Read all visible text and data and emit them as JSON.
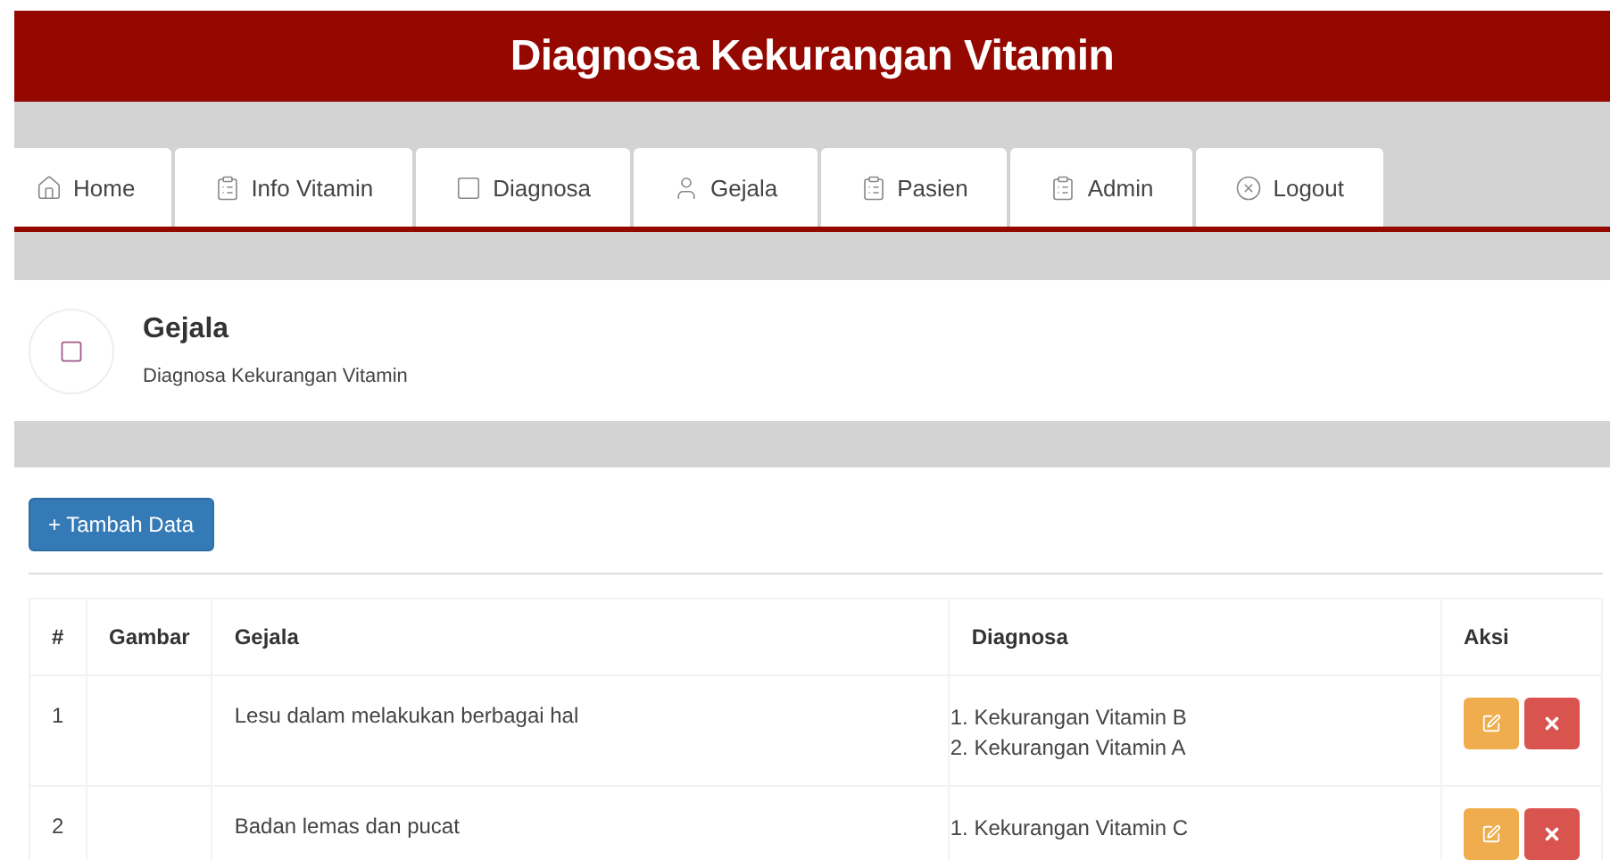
{
  "banner": {
    "title": "Diagnosa Kekurangan Vitamin"
  },
  "nav": [
    {
      "label": "Home",
      "kind": "home"
    },
    {
      "label": "Info Vitamin",
      "kind": "clipboard"
    },
    {
      "label": "Diagnosa",
      "kind": "square"
    },
    {
      "label": "Gejala",
      "kind": "user"
    },
    {
      "label": "Pasien",
      "kind": "clipboard"
    },
    {
      "label": "Admin",
      "kind": "clipboard"
    },
    {
      "label": "Logout",
      "kind": "logout"
    }
  ],
  "page_header": {
    "title": "Gejala",
    "subtitle": "Diagnosa Kekurangan Vitamin"
  },
  "add_button": "+ Tambah Data",
  "table": {
    "columns": [
      "#",
      "Gambar",
      "Gejala",
      "Diagnosa",
      "Aksi"
    ],
    "rows": [
      {
        "no": "1",
        "gejala": "Lesu dalam melakukan berbagai hal",
        "diagnosa": [
          "1. Kekurangan Vitamin B",
          "2. Kekurangan Vitamin A"
        ]
      },
      {
        "no": "2",
        "gejala": "Badan lemas dan pucat",
        "diagnosa": [
          "1. Kekurangan Vitamin C"
        ]
      }
    ]
  }
}
